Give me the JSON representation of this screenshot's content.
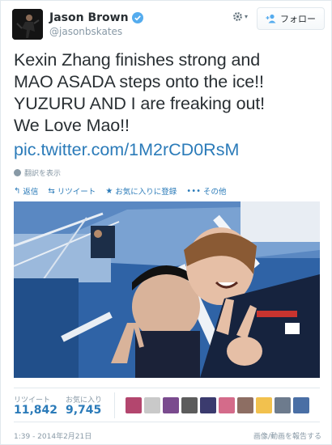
{
  "user": {
    "name": "Jason Brown",
    "handle": "@jasonbskates",
    "verified_color": "#55acee"
  },
  "follow_button": {
    "label": "フォロー"
  },
  "tweet": {
    "text": "Kexin Zhang finishes strong and\nMAO ASADA steps onto the ice!!\nYUZURU AND I are freaking out!\nWe Love Mao!!",
    "link": "pic.twitter.com/1M2rCD0RsM",
    "translate": "翻訳を表示"
  },
  "actions": [
    {
      "label": "返信",
      "icon": "reply-icon"
    },
    {
      "label": "リツイート",
      "icon": "retweet-icon"
    },
    {
      "label": "お気に入りに登録",
      "icon": "star-icon"
    },
    {
      "label": "その他",
      "icon": "more-icon"
    }
  ],
  "stats": {
    "retweets_label": "リツイート",
    "retweets": "11,842",
    "favorites_label": "お気に入り",
    "favorites": "9,745"
  },
  "timestamp": "1:39 - 2014年2月21日",
  "report": "画像/動画を報告する",
  "colors": {
    "link": "#2b7bb9",
    "muted": "#8899a6",
    "text": "#292f33"
  }
}
